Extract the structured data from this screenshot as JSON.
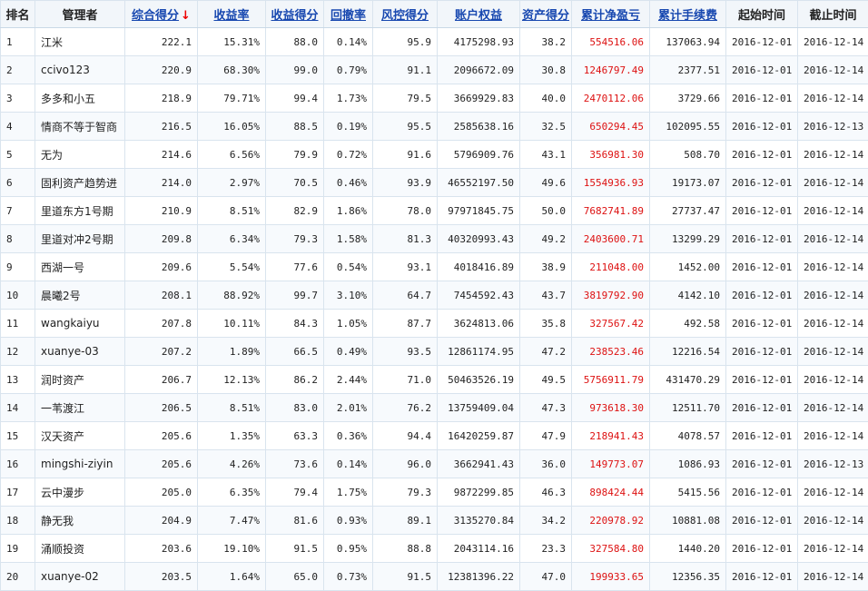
{
  "headers": {
    "rank": "排名",
    "manager": "管理者",
    "total_score": "综合得分",
    "sort_arrow": "↓",
    "return_rate": "收益率",
    "return_score": "收益得分",
    "drawdown": "回撤率",
    "risk_score": "风控得分",
    "equity": "账户权益",
    "asset_score": "资产得分",
    "net_pnl": "累计净盈亏",
    "fees": "累计手续费",
    "start": "起始时间",
    "end": "截止时间"
  },
  "colors": {
    "link": "#1848b0",
    "pnl": "#d11",
    "sort_arrow": "#e00"
  },
  "rows": [
    {
      "rank": "1",
      "name": "江米",
      "score": "222.1",
      "ret": "15.31%",
      "ret_score": "88.0",
      "dd": "0.14%",
      "risk": "95.9",
      "equity": "4175298.93",
      "asset": "38.2",
      "pnl": "554516.06",
      "fee": "137063.94",
      "start": "2016-12-01",
      "end": "2016-12-14"
    },
    {
      "rank": "2",
      "name": "ccivo123",
      "score": "220.9",
      "ret": "68.30%",
      "ret_score": "99.0",
      "dd": "0.79%",
      "risk": "91.1",
      "equity": "2096672.09",
      "asset": "30.8",
      "pnl": "1246797.49",
      "fee": "2377.51",
      "start": "2016-12-01",
      "end": "2016-12-14"
    },
    {
      "rank": "3",
      "name": "多多和小五",
      "score": "218.9",
      "ret": "79.71%",
      "ret_score": "99.4",
      "dd": "1.73%",
      "risk": "79.5",
      "equity": "3669929.83",
      "asset": "40.0",
      "pnl": "2470112.06",
      "fee": "3729.66",
      "start": "2016-12-01",
      "end": "2016-12-14"
    },
    {
      "rank": "4",
      "name": "情商不等于智商",
      "score": "216.5",
      "ret": "16.05%",
      "ret_score": "88.5",
      "dd": "0.19%",
      "risk": "95.5",
      "equity": "2585638.16",
      "asset": "32.5",
      "pnl": "650294.45",
      "fee": "102095.55",
      "start": "2016-12-01",
      "end": "2016-12-13"
    },
    {
      "rank": "5",
      "name": "无为",
      "score": "214.6",
      "ret": "6.56%",
      "ret_score": "79.9",
      "dd": "0.72%",
      "risk": "91.6",
      "equity": "5796909.76",
      "asset": "43.1",
      "pnl": "356981.30",
      "fee": "508.70",
      "start": "2016-12-01",
      "end": "2016-12-14"
    },
    {
      "rank": "6",
      "name": "固利资产趋势进",
      "score": "214.0",
      "ret": "2.97%",
      "ret_score": "70.5",
      "dd": "0.46%",
      "risk": "93.9",
      "equity": "46552197.50",
      "asset": "49.6",
      "pnl": "1554936.93",
      "fee": "19173.07",
      "start": "2016-12-01",
      "end": "2016-12-14"
    },
    {
      "rank": "7",
      "name": "里道东方1号期",
      "score": "210.9",
      "ret": "8.51%",
      "ret_score": "82.9",
      "dd": "1.86%",
      "risk": "78.0",
      "equity": "97971845.75",
      "asset": "50.0",
      "pnl": "7682741.89",
      "fee": "27737.47",
      "start": "2016-12-01",
      "end": "2016-12-14"
    },
    {
      "rank": "8",
      "name": "里道对冲2号期",
      "score": "209.8",
      "ret": "6.34%",
      "ret_score": "79.3",
      "dd": "1.58%",
      "risk": "81.3",
      "equity": "40320993.43",
      "asset": "49.2",
      "pnl": "2403600.71",
      "fee": "13299.29",
      "start": "2016-12-01",
      "end": "2016-12-14"
    },
    {
      "rank": "9",
      "name": "西湖一号",
      "score": "209.6",
      "ret": "5.54%",
      "ret_score": "77.6",
      "dd": "0.54%",
      "risk": "93.1",
      "equity": "4018416.89",
      "asset": "38.9",
      "pnl": "211048.00",
      "fee": "1452.00",
      "start": "2016-12-01",
      "end": "2016-12-14"
    },
    {
      "rank": "10",
      "name": "晨曦2号",
      "score": "208.1",
      "ret": "88.92%",
      "ret_score": "99.7",
      "dd": "3.10%",
      "risk": "64.7",
      "equity": "7454592.43",
      "asset": "43.7",
      "pnl": "3819792.90",
      "fee": "4142.10",
      "start": "2016-12-01",
      "end": "2016-12-14"
    },
    {
      "rank": "11",
      "name": "wangkaiyu",
      "score": "207.8",
      "ret": "10.11%",
      "ret_score": "84.3",
      "dd": "1.05%",
      "risk": "87.7",
      "equity": "3624813.06",
      "asset": "35.8",
      "pnl": "327567.42",
      "fee": "492.58",
      "start": "2016-12-01",
      "end": "2016-12-14"
    },
    {
      "rank": "12",
      "name": "xuanye-03",
      "score": "207.2",
      "ret": "1.89%",
      "ret_score": "66.5",
      "dd": "0.49%",
      "risk": "93.5",
      "equity": "12861174.95",
      "asset": "47.2",
      "pnl": "238523.46",
      "fee": "12216.54",
      "start": "2016-12-01",
      "end": "2016-12-14"
    },
    {
      "rank": "13",
      "name": "润时资产",
      "score": "206.7",
      "ret": "12.13%",
      "ret_score": "86.2",
      "dd": "2.44%",
      "risk": "71.0",
      "equity": "50463526.19",
      "asset": "49.5",
      "pnl": "5756911.79",
      "fee": "431470.29",
      "start": "2016-12-01",
      "end": "2016-12-14"
    },
    {
      "rank": "14",
      "name": "一苇渡江",
      "score": "206.5",
      "ret": "8.51%",
      "ret_score": "83.0",
      "dd": "2.01%",
      "risk": "76.2",
      "equity": "13759409.04",
      "asset": "47.3",
      "pnl": "973618.30",
      "fee": "12511.70",
      "start": "2016-12-01",
      "end": "2016-12-14"
    },
    {
      "rank": "15",
      "name": "汉天资产",
      "score": "205.6",
      "ret": "1.35%",
      "ret_score": "63.3",
      "dd": "0.36%",
      "risk": "94.4",
      "equity": "16420259.87",
      "asset": "47.9",
      "pnl": "218941.43",
      "fee": "4078.57",
      "start": "2016-12-01",
      "end": "2016-12-14"
    },
    {
      "rank": "16",
      "name": "mingshi-ziyin",
      "score": "205.6",
      "ret": "4.26%",
      "ret_score": "73.6",
      "dd": "0.14%",
      "risk": "96.0",
      "equity": "3662941.43",
      "asset": "36.0",
      "pnl": "149773.07",
      "fee": "1086.93",
      "start": "2016-12-01",
      "end": "2016-12-13"
    },
    {
      "rank": "17",
      "name": "云中漫步",
      "score": "205.0",
      "ret": "6.35%",
      "ret_score": "79.4",
      "dd": "1.75%",
      "risk": "79.3",
      "equity": "9872299.85",
      "asset": "46.3",
      "pnl": "898424.44",
      "fee": "5415.56",
      "start": "2016-12-01",
      "end": "2016-12-14"
    },
    {
      "rank": "18",
      "name": "静无我",
      "score": "204.9",
      "ret": "7.47%",
      "ret_score": "81.6",
      "dd": "0.93%",
      "risk": "89.1",
      "equity": "3135270.84",
      "asset": "34.2",
      "pnl": "220978.92",
      "fee": "10881.08",
      "start": "2016-12-01",
      "end": "2016-12-14"
    },
    {
      "rank": "19",
      "name": "涌顺投资",
      "score": "203.6",
      "ret": "19.10%",
      "ret_score": "91.5",
      "dd": "0.95%",
      "risk": "88.8",
      "equity": "2043114.16",
      "asset": "23.3",
      "pnl": "327584.80",
      "fee": "1440.20",
      "start": "2016-12-01",
      "end": "2016-12-14"
    },
    {
      "rank": "20",
      "name": "xuanye-02",
      "score": "203.5",
      "ret": "1.64%",
      "ret_score": "65.0",
      "dd": "0.73%",
      "risk": "91.5",
      "equity": "12381396.22",
      "asset": "47.0",
      "pnl": "199933.65",
      "fee": "12356.35",
      "start": "2016-12-01",
      "end": "2016-12-14"
    }
  ]
}
